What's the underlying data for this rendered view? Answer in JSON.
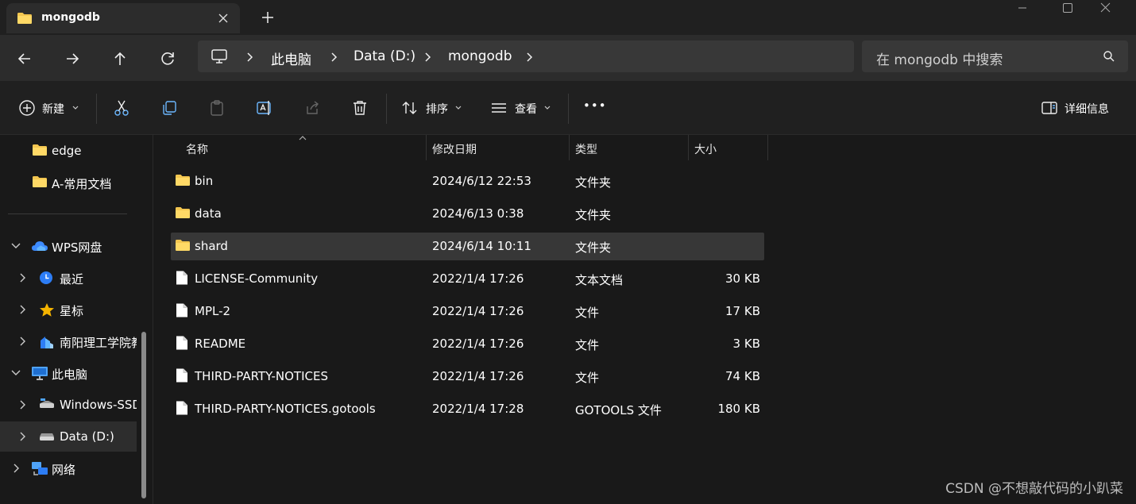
{
  "window": {
    "tab_title": "mongodb",
    "new_tab_symbol": "+"
  },
  "nav": {
    "breadcrumbs": [
      "此电脑",
      "Data (D:)",
      "mongodb"
    ],
    "search_placeholder": "在 mongodb 中搜索"
  },
  "toolbar": {
    "new_label": "新建",
    "sort_label": "排序",
    "view_label": "查看",
    "more_label": "•••",
    "details_label": "详细信息"
  },
  "sidebar": {
    "quick_items": [
      {
        "label": "edge",
        "icon": "folder-icon"
      },
      {
        "label": "A-常用文档",
        "icon": "folder-icon"
      }
    ],
    "tree_items": [
      {
        "label": "WPS网盘",
        "icon": "cloud-icon",
        "expand": "expanded"
      },
      {
        "label": "最近",
        "icon": "clock-icon",
        "expand": "collapsed"
      },
      {
        "label": "星标",
        "icon": "star-icon",
        "expand": "collapsed"
      },
      {
        "label": "南阳理工学院教",
        "icon": "team-drive-icon",
        "expand": "collapsed"
      },
      {
        "label": "此电脑",
        "icon": "computer-icon",
        "expand": "expanded"
      },
      {
        "label": "Windows-SSD",
        "icon": "drive-icon",
        "expand": "collapsed"
      },
      {
        "label": "Data (D:)",
        "icon": "drive-icon",
        "expand": "collapsed"
      },
      {
        "label": "网络",
        "icon": "network-icon",
        "expand": "collapsed"
      }
    ]
  },
  "columns": {
    "name": "名称",
    "date": "修改日期",
    "type": "类型",
    "size": "大小"
  },
  "files": [
    {
      "name": "bin",
      "date": "2024/6/12 22:53",
      "type": "文件夹",
      "size": "",
      "icon": "folder-icon"
    },
    {
      "name": "data",
      "date": "2024/6/13 0:38",
      "type": "文件夹",
      "size": "",
      "icon": "folder-icon"
    },
    {
      "name": "shard",
      "date": "2024/6/14 10:11",
      "type": "文件夹",
      "size": "",
      "icon": "folder-icon"
    },
    {
      "name": "LICENSE-Community",
      "date": "2022/1/4 17:26",
      "type": "文本文档",
      "size": "30 KB",
      "icon": "file-icon"
    },
    {
      "name": "MPL-2",
      "date": "2022/1/4 17:26",
      "type": "文件",
      "size": "17 KB",
      "icon": "file-icon"
    },
    {
      "name": "README",
      "date": "2022/1/4 17:26",
      "type": "文件",
      "size": "3 KB",
      "icon": "file-icon"
    },
    {
      "name": "THIRD-PARTY-NOTICES",
      "date": "2022/1/4 17:26",
      "type": "文件",
      "size": "74 KB",
      "icon": "file-icon"
    },
    {
      "name": "THIRD-PARTY-NOTICES.gotools",
      "date": "2022/1/4 17:28",
      "type": "GOTOOLS 文件",
      "size": "180 KB",
      "icon": "file-icon"
    }
  ],
  "selected_file": "shard",
  "watermark": "CSDN @不想敲代码的小趴菜"
}
